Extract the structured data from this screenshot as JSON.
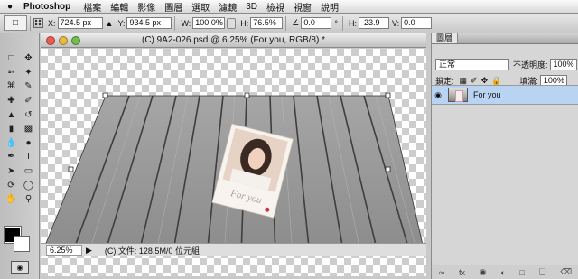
{
  "menubar": {
    "app_name": "Photoshop",
    "items": [
      "檔案",
      "編輯",
      "影像",
      "圖層",
      "選取",
      "濾鏡",
      "3D",
      "檢視",
      "視窗",
      "說明"
    ]
  },
  "options": {
    "x_label": "X:",
    "x_value": "724.5 px",
    "y_label": "Y:",
    "y_value": "934.5 px",
    "w_label": "W:",
    "w_value": "100.0%",
    "h_label": "H:",
    "h_value": "76.5%",
    "angle_value": "0.0",
    "hskew_label": "H:",
    "hskew_value": "-23.9",
    "vskew_label": "V:",
    "vskew_value": "0.0"
  },
  "document": {
    "title": "(C) 9A2-026.psd @ 6.25% (For you, RGB/8) *",
    "zoom": "6.25%",
    "info": "(C) 文件: 128.5M/0 位元組",
    "photo_caption": "For you"
  },
  "layers_panel": {
    "tab_label": "圖層",
    "blend_mode": "正常",
    "opacity_label": "不透明度:",
    "opacity_value": "100%",
    "lock_label": "鎖定:",
    "fill_label": "填滿:",
    "fill_value": "100%",
    "layers": [
      {
        "name": "For you",
        "visible": true,
        "selected": true
      }
    ]
  },
  "colors": {
    "foreground": "#000000",
    "background": "#ffffff",
    "selected_layer": "#b9d3f2"
  }
}
